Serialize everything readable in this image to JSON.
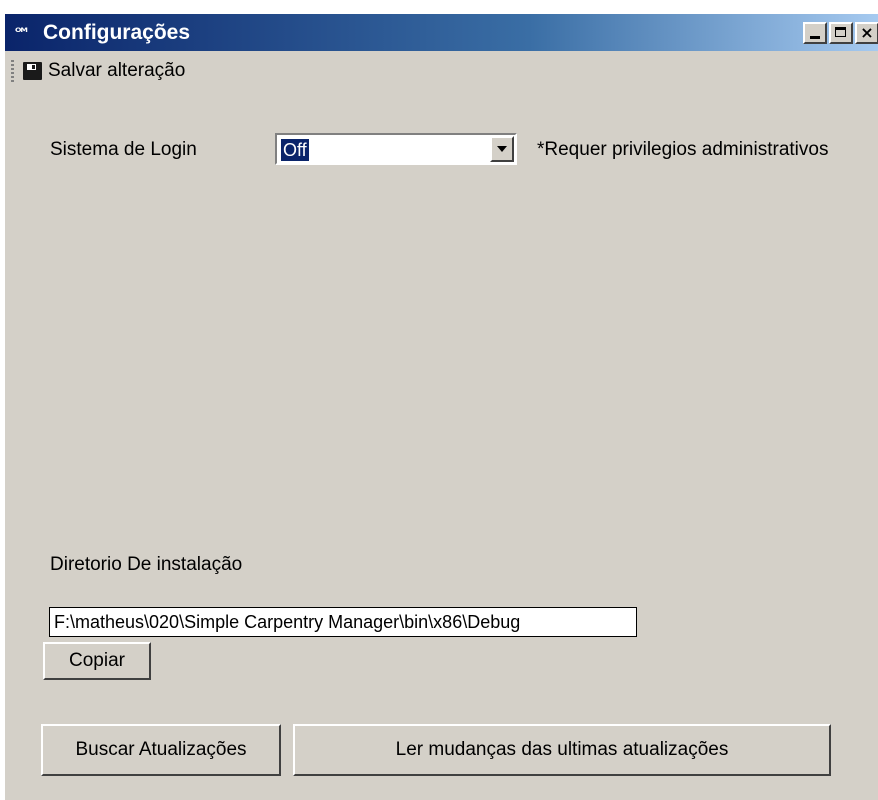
{
  "window": {
    "title": "Configurações",
    "icon_text": "SCM",
    "controls": {
      "minimize": "_",
      "maximize": "□",
      "close": "×"
    }
  },
  "toolbar": {
    "save_label": "Salvar alteração"
  },
  "login": {
    "label": "Sistema de Login",
    "selected": "Off",
    "note": "*Requer privilegios administrativos"
  },
  "install": {
    "label": "Diretorio De instalação",
    "path": "F:\\matheus\\020\\Simple Carpentry Manager\\bin\\x86\\Debug",
    "copy_label": "Copiar"
  },
  "actions": {
    "check_updates": "Buscar Atualizações",
    "read_changes": "Ler mudanças das ultimas atualizações"
  },
  "colors": {
    "face": "#d4d0c8",
    "titlebar_start": "#0a246a",
    "titlebar_end": "#a6caf0",
    "selection": "#0a246a"
  }
}
